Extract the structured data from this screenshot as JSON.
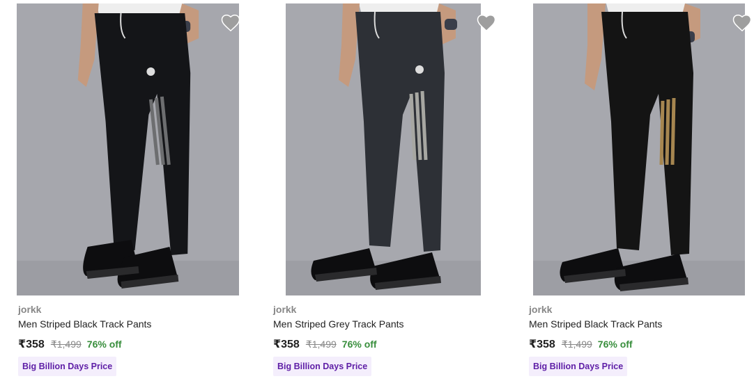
{
  "products": [
    {
      "brand": "jorkk",
      "title": "Men Striped Black Track Pants",
      "price": "₹358",
      "mrp": "₹1,499",
      "discount": "76% off",
      "badge": "Big Billion Days Price",
      "pant_color": "#141518",
      "stripe_color": "#6d6e70"
    },
    {
      "brand": "jorkk",
      "title": "Men Striped Grey Track Pants",
      "price": "₹358",
      "mrp": "₹1,499",
      "discount": "76% off",
      "badge": "Big Billion Days Price",
      "pant_color": "#2d3036",
      "stripe_color": "#a7a7a2"
    },
    {
      "brand": "jorkk",
      "title": "Men Striped Black Track Pants",
      "price": "₹358",
      "mrp": "₹1,499",
      "discount": "76% off",
      "badge": "Big Billion Days Price",
      "pant_color": "#141414",
      "stripe_color": "#a68650"
    }
  ],
  "icons": {
    "wishlist": "heart-icon"
  }
}
